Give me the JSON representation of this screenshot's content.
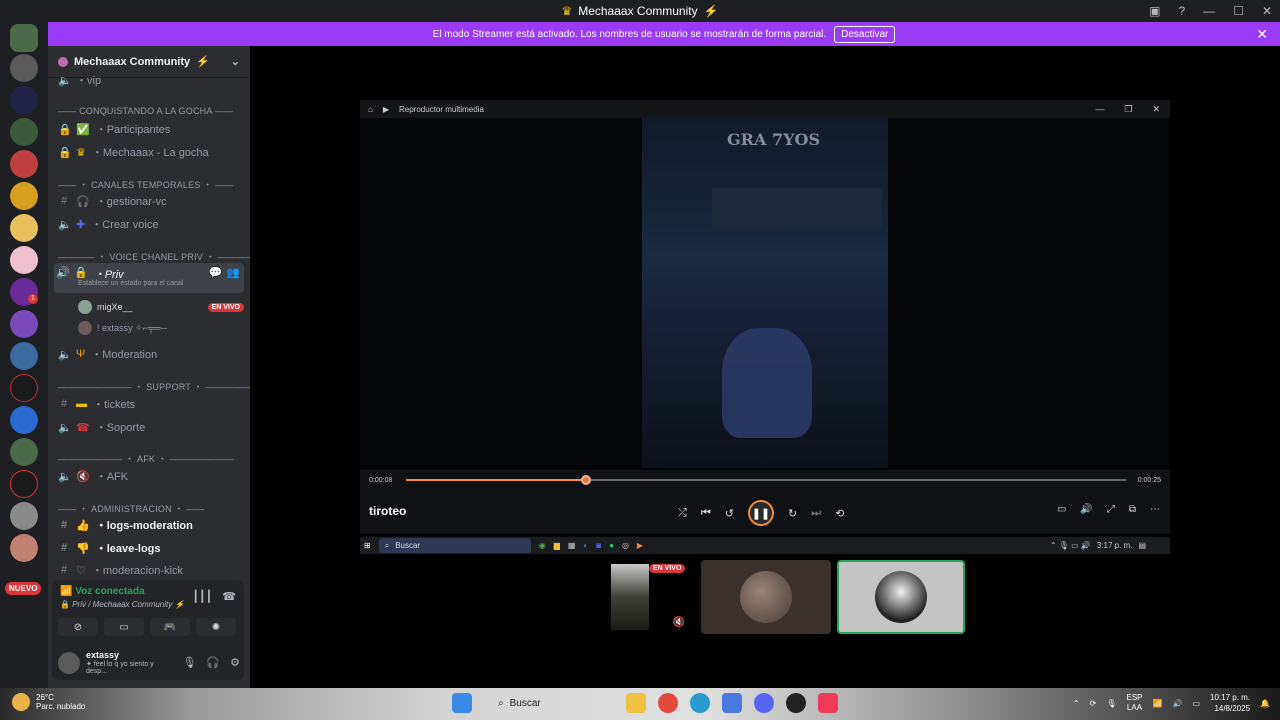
{
  "window": {
    "title": "Mechaaax Community",
    "title_emoji": "⚡"
  },
  "banner": {
    "text": "El modo Streamer está activado. Los nombres de usuario se mostrarán de forma parcial.",
    "button": "Desactivar"
  },
  "servers": {
    "badge_count": "1",
    "new_label": "NUEVO"
  },
  "guild": {
    "name": "Mechaaax Community",
    "emoji": "⚡"
  },
  "channels": {
    "vip": "・vip",
    "cat1": "—— CONQUISTANDO A LA GOCHA ——",
    "participantes": "・Participantes",
    "lagocha": "・Mechaaax - La gocha",
    "cat2": "—— ・ CANALES TEMPORALES ・ ——",
    "gestionar": "・gestionar-vc",
    "crear": "・Crear voice",
    "cat3": "———— ・ VOICE CHANEL PRIV ・ ————",
    "priv": "・Priv",
    "priv_sub": "Establece un estado para el canal",
    "user1": "migXe__",
    "user1_live": "EN VIVO",
    "user2": "! extassy ✧⌐╤═─",
    "moderation": "・Moderation",
    "cat4": "———————— ・ SUPPORT ・ ————————",
    "tickets": "・tickets",
    "soporte": "・Soporte",
    "cat5": "——————— ・ AFK ・ ———————",
    "afk": "・AFK",
    "cat6": "—— ・ ADMINISTRACION ・ ——",
    "logs": "・logs-moderation",
    "leave": "・leave-logs",
    "kick": "・moderacion-kick"
  },
  "voice": {
    "status": "Voz conectada",
    "where": "Priv / Mechaaax Community ⚡"
  },
  "me": {
    "name": "extassy",
    "status": "✦ feel lo q yo siento y desp..."
  },
  "player": {
    "app_title": "Reproductor multimedia",
    "sign_text": "GRA 7YOS",
    "time_current": "0:00:08",
    "time_total": "0:00:25",
    "progress": 0.25,
    "video_title": "tiroteo"
  },
  "mini_taskbar": {
    "search": "Buscar",
    "time": "3:17 p. m."
  },
  "tiles": {
    "live": "EN VIVO"
  },
  "taskbar": {
    "temp": "26°C",
    "weather": "Parc. nublado",
    "search": "Buscar",
    "lang1": "ESP",
    "lang2": "LAA",
    "time": "10:17 p. m.",
    "date": "14/8/2025"
  },
  "colors": {
    "accent": "#9c3bf5",
    "live": "#da373c",
    "connected": "#23a55a",
    "progress": "#f0913a"
  }
}
